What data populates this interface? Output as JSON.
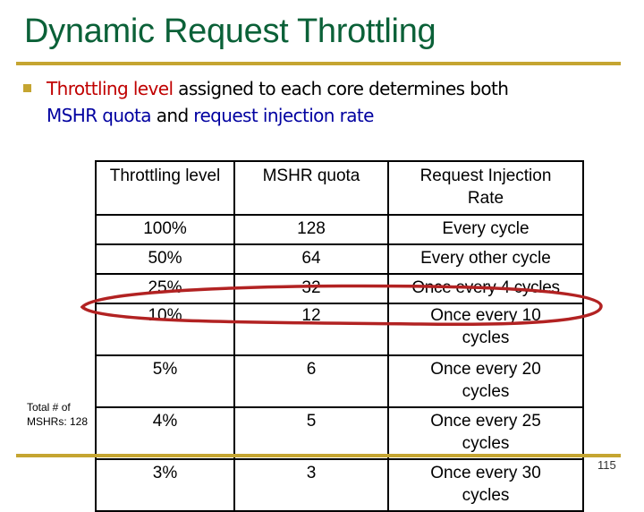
{
  "slide": {
    "title": "Dynamic Request Throttling",
    "bullet": {
      "segments": [
        {
          "text": "Throttling level",
          "color": "red"
        },
        {
          "text": " assigned to each core determines both",
          "color": "black"
        },
        {
          "text": "MSHR quota",
          "color": "blue"
        },
        {
          "text": " and ",
          "color": "black"
        },
        {
          "text": "request injection rate",
          "color": "blue"
        }
      ]
    },
    "table": {
      "headers": [
        "Throttling level",
        "MSHR quota",
        "Request Injection\nRate"
      ],
      "rows": [
        [
          "100%",
          "128",
          "Every cycle"
        ],
        [
          "50%",
          "64",
          "Every other cycle"
        ],
        [
          "25%",
          "32",
          "Once every 4 cycles"
        ],
        [
          "10%",
          "12",
          "Once every 10\ncycles"
        ],
        [
          "5%",
          "6",
          "Once every 20\ncycles"
        ],
        [
          "4%",
          "5",
          "Once every 25\ncycles"
        ],
        [
          "3%",
          "3",
          "Once every 30\ncycles"
        ]
      ],
      "highlighted_row": "10%"
    },
    "side_note": "Total # of\nMSHRs: 128",
    "page_number": "115",
    "colors": {
      "title": "#0b6138",
      "rule": "#c5a531",
      "highlight_ellipse": "#b22222",
      "emphasis_red": "#c00000",
      "emphasis_blue": "#0000a0"
    }
  }
}
